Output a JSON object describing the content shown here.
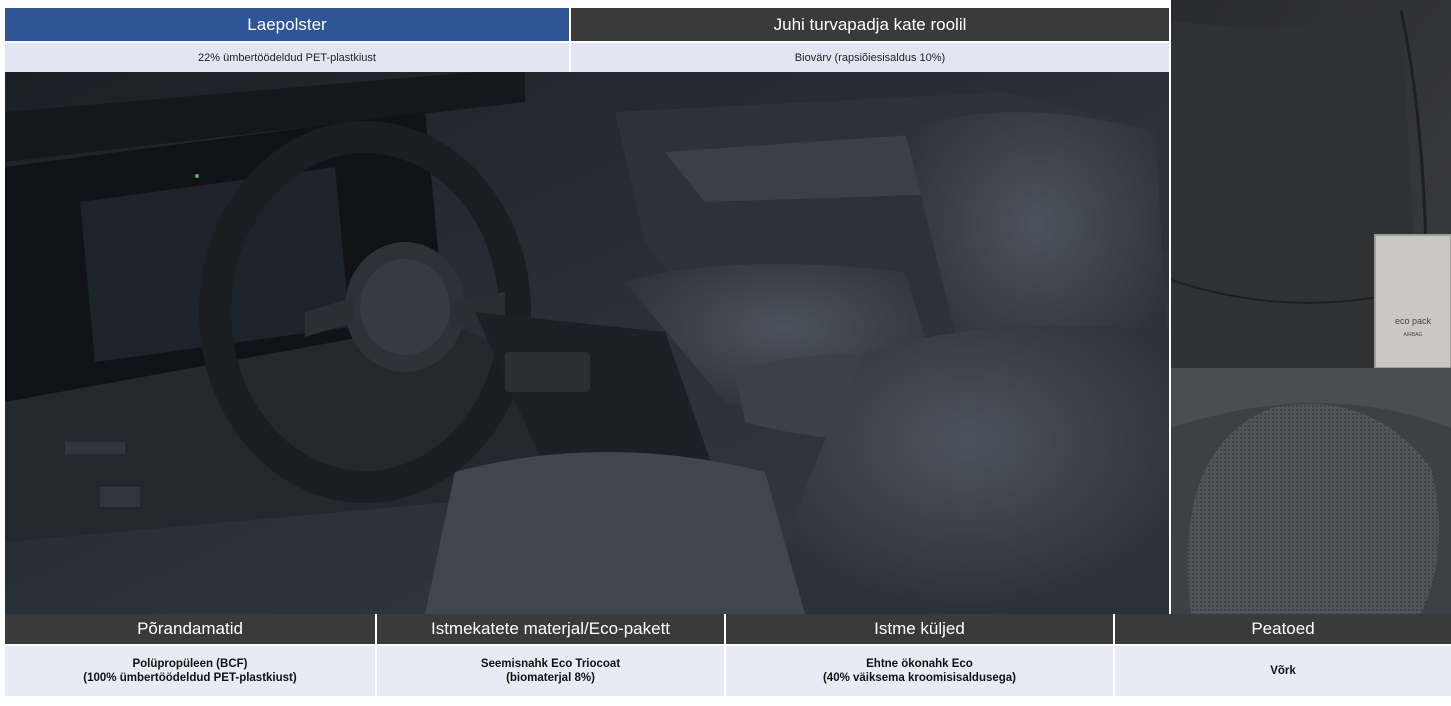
{
  "top_headers": {
    "left": {
      "title": "Laepolster",
      "subtitle": "22% ümbertöödeldud PET-plastkiust"
    },
    "right": {
      "title": "Juhi turvapadja kate roolil",
      "subtitle": "Biovärv (rapsiõiesisaldus 10%)"
    }
  },
  "bottom_headers": [
    {
      "title": "Põrandamatid",
      "subtitle": "Polüpropüleen (BCF)\n(100% ümbertöödeldud PET-plastkiust)"
    },
    {
      "title": "Istmekatete materjal/Eco-pakett",
      "subtitle": "Seemisnahk Eco Triocoat\n(biomaterjal 8%)"
    },
    {
      "title": "Istme küljed",
      "subtitle": "Ehtne ökonahk Eco\n(40% väiksema kroomisisaldusega)"
    },
    {
      "title": "Peatoed",
      "subtitle": "Võrk"
    }
  ],
  "eco_badge": {
    "title": "eco pack",
    "subtitle": "AIRBAG"
  },
  "colors": {
    "blue_header": "#2f5597",
    "dark_header": "#3a3a3a",
    "sub_row": "#e3e6f2"
  }
}
